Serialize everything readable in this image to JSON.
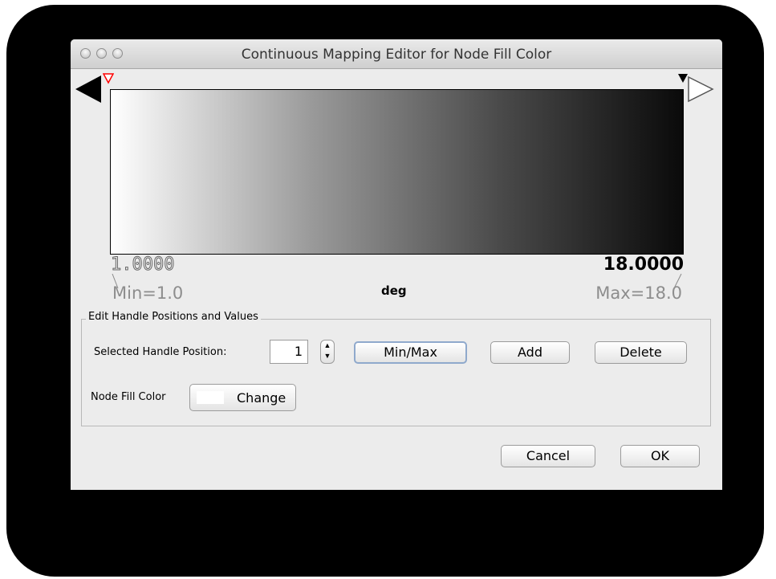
{
  "window": {
    "title": "Continuous Mapping Editor for Node Fill Color"
  },
  "gradient": {
    "min_value": "1.0000",
    "max_value": "18.0000",
    "min_label": "Min=1.0",
    "max_label": "Max=18.0",
    "attribute": "deg",
    "start_color": "#ffffff",
    "end_color": "#000000",
    "handle_colors": {
      "left_selected": "#ff0000",
      "right": "#000000"
    }
  },
  "edit_panel": {
    "title": "Edit Handle Positions and Values",
    "position_label": "Selected Handle Position:",
    "position_value": "1",
    "minmax_label": "Min/Max",
    "add_label": "Add",
    "delete_label": "Delete",
    "color_label": "Node Fill Color",
    "change_label": "Change",
    "current_color": "#ffffff"
  },
  "footer": {
    "cancel_label": "Cancel",
    "ok_label": "OK"
  }
}
